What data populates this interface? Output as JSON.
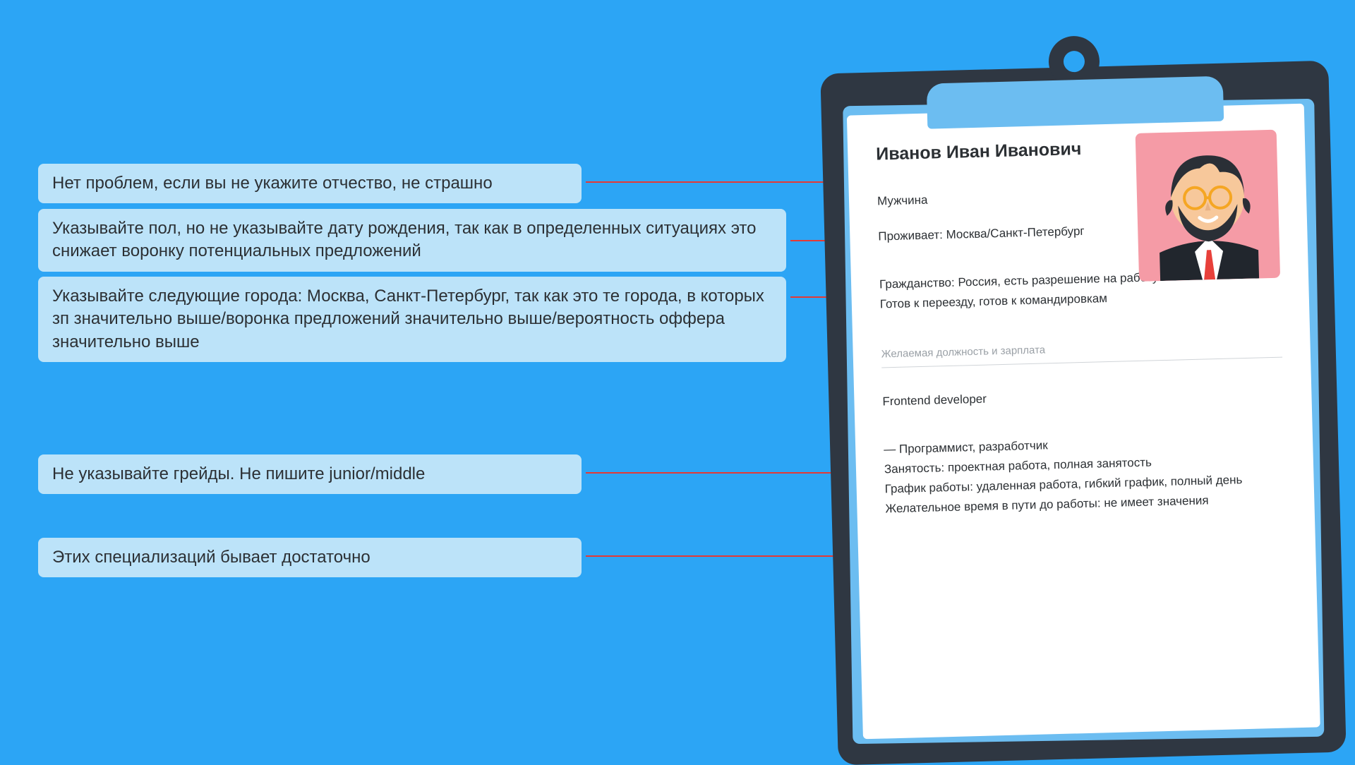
{
  "callouts": {
    "c1": "Нет проблем, если вы не укажите отчество, не страшно",
    "c2": "Указывайте пол, но не указывайте дату рождения, так как в определенных ситуациях это снижает воронку потенциальных предложений",
    "c3": "Указывайте следующие города: Москва, Санкт-Петербург, так как это те города, в которых зп значительно выше/воронка предложений значительно выше/вероятность оффера значительно выше",
    "c4": "Не указывайте грейды. Не пишите junior/middle",
    "c5": "Этих специализаций бывает достаточно"
  },
  "resume": {
    "name": "Иванов Иван Иванович",
    "gender": "Мужчина",
    "location": "Проживает: Москва/Санкт-Петербург",
    "citizenship": "Гражданство: Россия, есть разрешение на работу",
    "relocation": "Готов к переезду, готов к командировкам",
    "section_title": "Желаемая должность и зарплата",
    "position": "Frontend developer",
    "spec": "— Программист, разработчик",
    "employment": "Занятость: проектная работа, полная занятость",
    "schedule": "График работы: удаленная работа, гибкий график, полный день",
    "commute": "Желательное время в пути до работы: не имеет значения"
  }
}
